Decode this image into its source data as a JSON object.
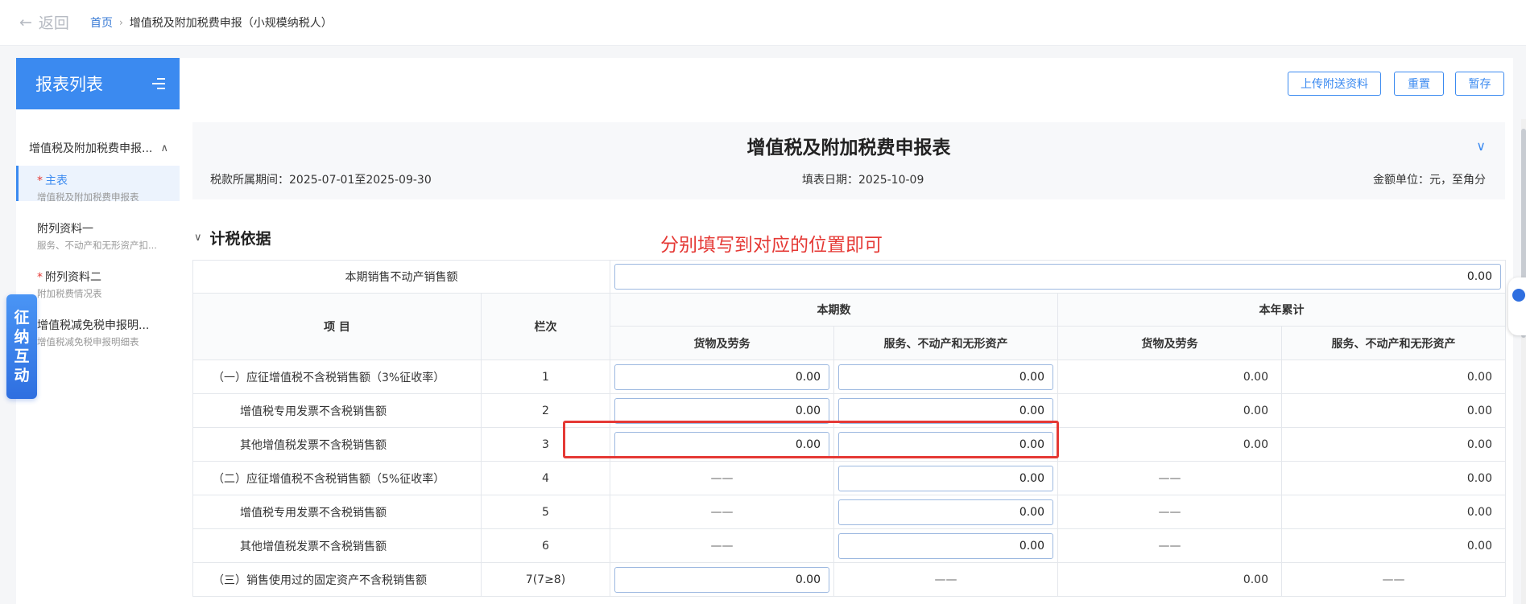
{
  "topbar": {
    "back_label": "返回",
    "crumb_home": "首页",
    "crumb_current": "增值税及附加税费申报（小规模纳税人）"
  },
  "sidebar": {
    "title": "报表列表",
    "group_title": "增值税及附加税费申报...",
    "items": [
      {
        "name": "主表",
        "sub": "增值税及附加税费申报表",
        "required": "*",
        "active": true
      },
      {
        "name": "附列资料一",
        "sub": "服务、不动产和无形资产扣...",
        "required": "",
        "active": false
      },
      {
        "name": "附列资料二",
        "sub": "附加税费情况表",
        "required": "*",
        "active": false
      },
      {
        "name": "增值税减免税申报明...",
        "sub": "增值税减免税申报明细表",
        "required": "",
        "active": false
      }
    ]
  },
  "float_tab": {
    "chars": [
      "征",
      "纳",
      "互",
      "动"
    ]
  },
  "toolbar": {
    "upload_label": "上传附送资料",
    "reset_label": "重置",
    "save_label": "暂存"
  },
  "form": {
    "title": "增值税及附加税费申报表",
    "period_label": "税款所属期间：2025-07-01至2025-09-30",
    "fill_date_label": "填表日期：2025-10-09",
    "unit_label": "金额单位：元，至角分"
  },
  "section": {
    "title": "计税依据"
  },
  "annotation": "分别填写到对应的位置即可",
  "table": {
    "top_row": {
      "label": "本期销售不动产销售额",
      "value": "0.00"
    },
    "headers": {
      "item": "项    目",
      "col": "栏次",
      "current": "本期数",
      "ytd": "本年累计",
      "goods": "货物及劳务",
      "services": "服务、不动产和无形资产",
      "goods2": "货物及劳务",
      "services2": "服务、不动产和无形资产"
    },
    "rows": [
      {
        "label": "（一）应征增值税不含税销售额（3%征收率）",
        "col": "1",
        "c1": "0.00",
        "c2": "0.00",
        "c3": "0.00",
        "c4": "0.00"
      },
      {
        "label": "增值税专用发票不含税销售额",
        "col": "2",
        "c1": "0.00",
        "c2": "0.00",
        "c3": "0.00",
        "c4": "0.00"
      },
      {
        "label": "其他增值税发票不含税销售额",
        "col": "3",
        "c1": "0.00",
        "c2": "0.00",
        "c3": "0.00",
        "c4": "0.00"
      },
      {
        "label": "（二）应征增值税不含税销售额（5%征收率）",
        "col": "4",
        "c1": "——",
        "c2": "0.00",
        "c3": "——",
        "c4": "0.00"
      },
      {
        "label": "增值税专用发票不含税销售额",
        "col": "5",
        "c1": "——",
        "c2": "0.00",
        "c3": "——",
        "c4": "0.00"
      },
      {
        "label": "其他增值税发票不含税销售额",
        "col": "6",
        "c1": "——",
        "c2": "0.00",
        "c3": "——",
        "c4": "0.00"
      },
      {
        "label": "（三）销售使用过的固定资产不含税销售额",
        "col": "7(7≥8)",
        "c1": "0.00",
        "c2": "——",
        "c3": "0.00",
        "c4": "——"
      }
    ]
  }
}
